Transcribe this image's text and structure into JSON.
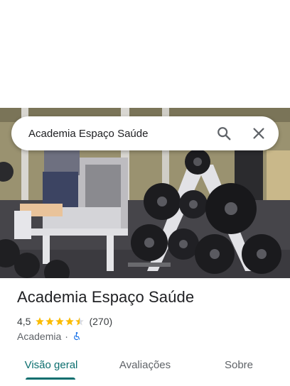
{
  "search": {
    "query": "Academia Espaço Saúde",
    "search_icon": "search-icon",
    "close_icon": "close-icon"
  },
  "photo": {
    "subject": "gym-interior-photo"
  },
  "place": {
    "title": "Academia Espaço Saúde",
    "rating": "4,5",
    "rating_stars": 4.5,
    "review_count": "(270)",
    "category": "Academia",
    "separator": "·",
    "accessibility_icon": "wheelchair-accessible-icon"
  },
  "tabs": [
    {
      "label": "Visão geral",
      "active": true
    },
    {
      "label": "Avaliações",
      "active": false
    },
    {
      "label": "Sobre",
      "active": false
    }
  ],
  "colors": {
    "star": "#fbbc04",
    "accent": "#0b6e6e",
    "accessibility": "#1a73e8"
  }
}
